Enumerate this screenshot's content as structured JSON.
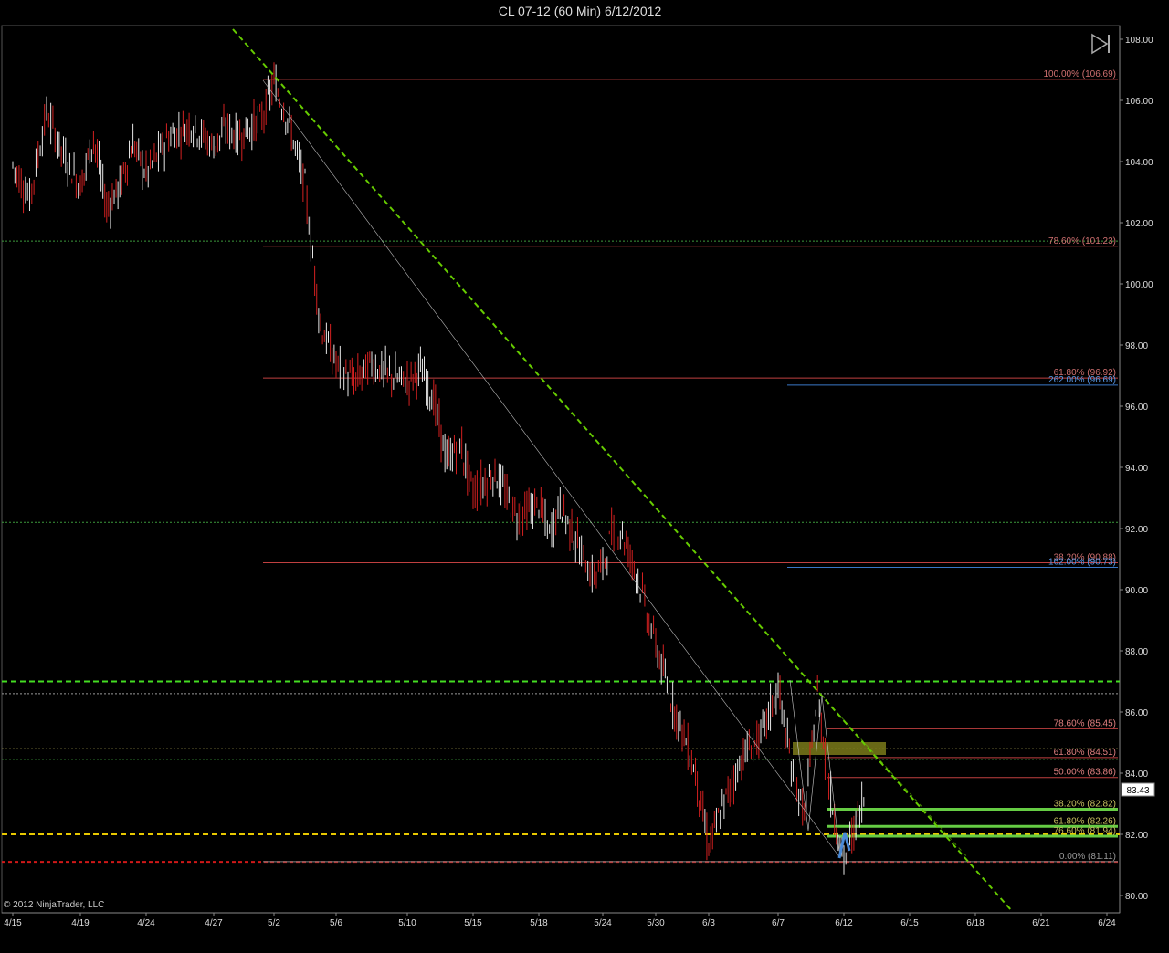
{
  "title": "CL 07-12 (60 Min)  6/12/2012",
  "copyright": "© 2012 NinjaTrader, LLC",
  "last_price": "83.43",
  "colors": {
    "background": "#000000",
    "up_candle": "#e6e6e6",
    "down_candle": "#d42020",
    "trendline_green": "#66cc00",
    "fib_red": "#c04040",
    "fib_blue": "#3a78c8",
    "support_yellow": "#e8c800",
    "support_red": "#d01818",
    "zone_olive": "#7a7a1a",
    "green_lines": "#66cc44"
  },
  "toolbar": {
    "icon": "skip-to-end-icon"
  },
  "chart_data": {
    "type": "candlestick",
    "title": "CL 07-12 (60 Min)  6/12/2012",
    "ylim": [
      79.5,
      108.3
    ],
    "y_ticks": [
      "108.00",
      "106.00",
      "104.00",
      "102.00",
      "100.00",
      "98.00",
      "96.00",
      "94.00",
      "92.00",
      "90.00",
      "88.00",
      "86.00",
      "84.00",
      "82.00",
      "80.00"
    ],
    "x_ticks": [
      "4/15",
      "4/19",
      "4/24",
      "4/27",
      "5/2",
      "5/6",
      "5/10",
      "5/15",
      "5/18",
      "5/24",
      "5/30",
      "6/3",
      "6/7",
      "6/12",
      "6/15",
      "6/18",
      "6/21",
      "6/24"
    ],
    "price_path": [
      [
        "4/15",
        103.9
      ],
      [
        "4/16",
        102.8
      ],
      [
        "4/17",
        105.6
      ],
      [
        "4/18",
        104.2
      ],
      [
        "4/19",
        103.2
      ],
      [
        "4/20",
        104.8
      ],
      [
        "4/21",
        102.5
      ],
      [
        "4/22",
        103.2
      ],
      [
        "4/23",
        104.6
      ],
      [
        "4/24",
        103.6
      ],
      [
        "4/25",
        104.8
      ],
      [
        "4/26",
        105.2
      ],
      [
        "4/27",
        104.5
      ],
      [
        "4/28",
        105.1
      ],
      [
        "4/29",
        104.8
      ],
      [
        "5/1",
        105.4
      ],
      [
        "5/2",
        106.6
      ],
      [
        "5/3",
        105.2
      ],
      [
        "5/4",
        103.2
      ],
      [
        "5/5",
        98.6
      ],
      [
        "5/6",
        97.4
      ],
      [
        "5/7",
        96.8
      ],
      [
        "5/8",
        97.4
      ],
      [
        "5/9",
        97.0
      ],
      [
        "5/10",
        96.8
      ],
      [
        "5/11",
        97.2
      ],
      [
        "5/12",
        96.2
      ],
      [
        "5/13",
        94.2
      ],
      [
        "5/14",
        94.8
      ],
      [
        "5/15",
        93.2
      ],
      [
        "5/16",
        93.8
      ],
      [
        "5/17",
        92.4
      ],
      [
        "5/18",
        92.8
      ],
      [
        "5/19",
        91.8
      ],
      [
        "5/20",
        92.8
      ],
      [
        "5/22",
        91.2
      ],
      [
        "5/23",
        90.4
      ],
      [
        "5/24",
        90.8
      ],
      [
        "5/25",
        91.8
      ],
      [
        "5/26",
        92.0
      ],
      [
        "5/28",
        90.4
      ],
      [
        "5/29",
        89.2
      ],
      [
        "5/30",
        88.2
      ],
      [
        "5/31",
        86.6
      ],
      [
        "6/1",
        85.4
      ],
      [
        "6/2",
        84.0
      ],
      [
        "6/3",
        81.6
      ],
      [
        "6/4",
        83.2
      ],
      [
        "6/5",
        84.6
      ],
      [
        "6/6",
        85.2
      ],
      [
        "6/7",
        86.8
      ],
      [
        "6/8",
        84.2
      ],
      [
        "6/9",
        82.6
      ],
      [
        "6/10",
        86.6
      ],
      [
        "6/11",
        83.2
      ],
      [
        "6/12",
        81.11
      ],
      [
        "6/13",
        83.43
      ]
    ],
    "fib_retracement_1": [
      {
        "label": "100.00% (106.69)",
        "price": 106.69
      },
      {
        "label": "78.60% (101.23)",
        "price": 101.23
      },
      {
        "label": "61.80% (96.92)",
        "price": 96.92
      },
      {
        "label": "38.20% (90.88)",
        "price": 90.88
      }
    ],
    "fib_extension": [
      {
        "label": "262.00% (96.69)",
        "price": 96.69
      },
      {
        "label": "162.00% (90.73)",
        "price": 90.73
      }
    ],
    "fib_retracement_2": [
      {
        "label": "78.60% (85.45)",
        "price": 85.45
      },
      {
        "label": "61.80% (84.51)",
        "price": 84.51
      },
      {
        "label": "50.00% (83.86)",
        "price": 83.86
      },
      {
        "label": "38.20% (82.82)",
        "price": 82.82
      },
      {
        "label": "61.80% (82.26)",
        "price": 82.26
      },
      {
        "label": "76.60% (81.94)",
        "price": 81.94
      },
      {
        "label": "0.00% (81.11)",
        "price": 81.11
      }
    ],
    "horizontal_levels": [
      {
        "price": 101.4,
        "style": "dotted-green"
      },
      {
        "price": 92.2,
        "style": "dotted-green"
      },
      {
        "price": 87.0,
        "style": "dashed-green"
      },
      {
        "price": 86.6,
        "style": "dotted-gray"
      },
      {
        "price": 84.8,
        "style": "dotted-yellow"
      },
      {
        "price": 84.45,
        "style": "dotted-green"
      },
      {
        "price": 82.0,
        "style": "dashed-yellow"
      },
      {
        "price": 81.1,
        "style": "dashed-red"
      }
    ]
  }
}
